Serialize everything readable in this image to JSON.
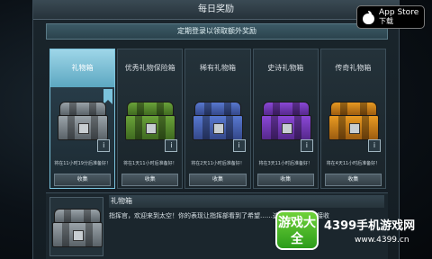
{
  "header": {
    "title": "每日奖励",
    "subtitle": "定期登录以领取额外奖励"
  },
  "tabs": [
    {
      "label": "礼物箱",
      "active": true,
      "chest_color": "#9aa3a9",
      "chest_dark": "#5a6268",
      "timer": "将在11小时19分后准备好！",
      "button": "收集"
    },
    {
      "label": "优秀礼物保险箱",
      "active": false,
      "chest_color": "#6aa23a",
      "chest_dark": "#3f6a20",
      "timer": "将在1天11小时后准备好！",
      "button": "收集"
    },
    {
      "label": "稀有礼物箱",
      "active": false,
      "chest_color": "#5878d0",
      "chest_dark": "#34488a",
      "timer": "将在2天11小时后准备好！",
      "button": "收集"
    },
    {
      "label": "史诗礼物箱",
      "active": false,
      "chest_color": "#8a48d6",
      "chest_dark": "#56288c",
      "timer": "将在3天11小时后准备好！",
      "button": "收集"
    },
    {
      "label": "传奇礼物箱",
      "active": false,
      "chest_color": "#e89a22",
      "chest_dark": "#9c5c10",
      "timer": "将在4天11小时后准备好！",
      "button": "收集"
    }
  ],
  "detail": {
    "title": "礼物箱",
    "text": "指挥官，欢迎来到太空！你的表现让指挥部看到了希望……这只保险箱，请接收"
  },
  "appstore": {
    "line1": "App Store",
    "line2": "下载"
  },
  "watermark": {
    "badge": "游戏大全",
    "site": "4399手机游戏网",
    "url": "www.4399.cn"
  },
  "colors": {
    "active_tab": "#7bc3dc",
    "accent": "#5ca7c1"
  }
}
